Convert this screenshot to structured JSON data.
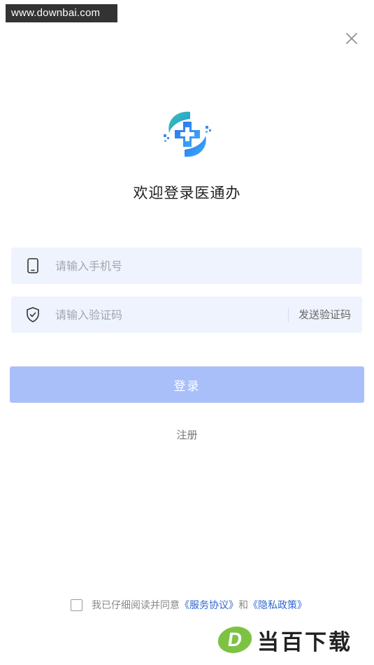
{
  "watermark_top": "www.downbai.com",
  "title": "欢迎登录医通办",
  "phone": {
    "placeholder": "请输入手机号",
    "value": ""
  },
  "code": {
    "placeholder": "请输入验证码",
    "value": "",
    "send_label": "发送验证码"
  },
  "login_label": "登录",
  "register_label": "注册",
  "agreement": {
    "prefix": "我已仔细阅读并同意",
    "service_link": "《服务协议》",
    "and": "和",
    "privacy_link": "《隐私政策》",
    "checked": false
  },
  "watermark_bottom": {
    "logo_letter": "D",
    "text": "当百下载"
  },
  "colors": {
    "accent": "#a9bff9",
    "link": "#3266d1",
    "field_bg": "#eef3fd"
  }
}
